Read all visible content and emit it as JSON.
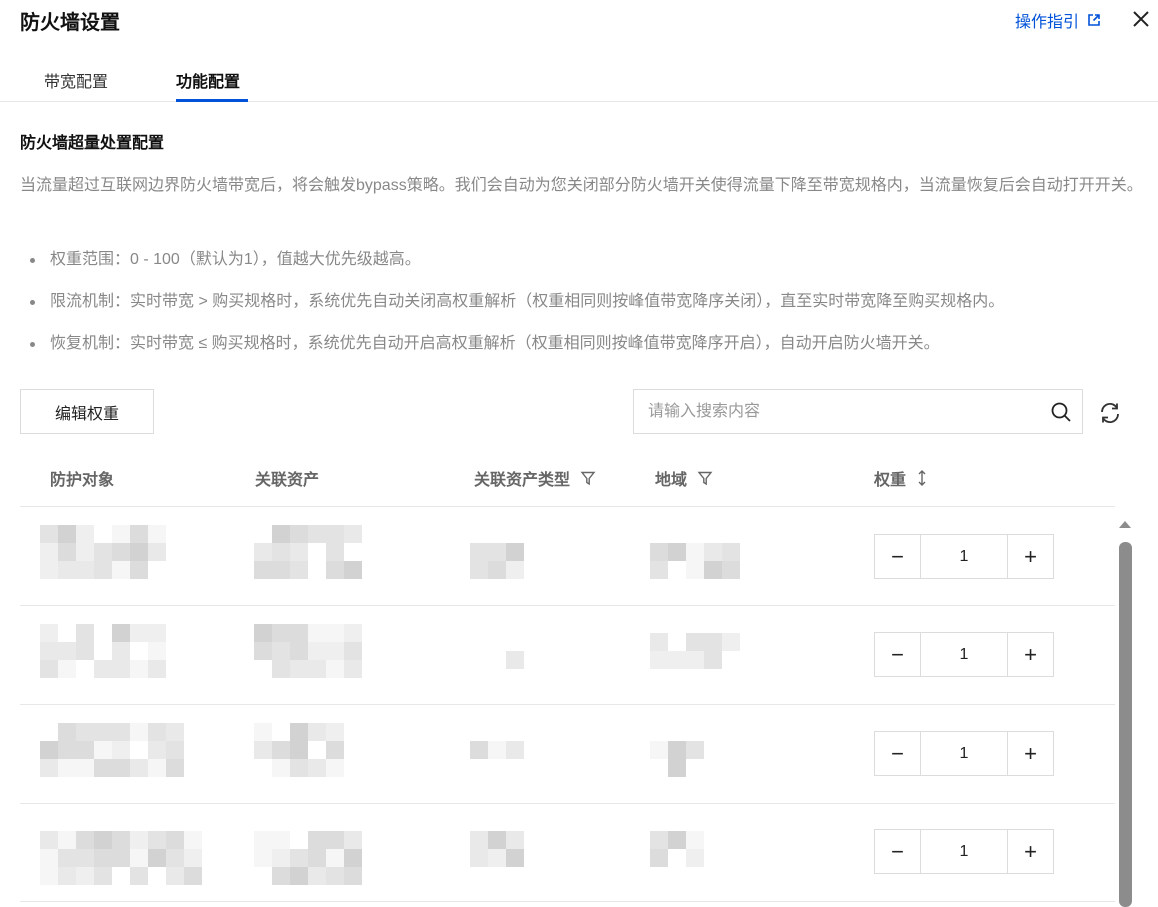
{
  "header": {
    "title": "防火墙设置",
    "guide_label": "操作指引"
  },
  "tabs": [
    {
      "label": "带宽配置",
      "active": false
    },
    {
      "label": "功能配置",
      "active": true
    }
  ],
  "section": {
    "title": "防火墙超量处置配置",
    "description": "当流量超过互联网边界防火墙带宽后，将会触发bypass策略。我们会自动为您关闭部分防火墙开关使得流量下降至带宽规格内，当流量恢复后会自动打开开关。",
    "bullets": [
      "权重范围：0 - 100（默认为1），值越大优先级越高。",
      "限流机制：实时带宽 > 购买规格时，系统优先自动关闭高权重解析（权重相同则按峰值带宽降序关闭），直至实时带宽降至购买规格内。",
      "恢复机制：实时带宽 ≤ 购买规格时，系统优先自动开启高权重解析（权重相同则按峰值带宽降序开启），自动开启防火墙开关。"
    ]
  },
  "toolbar": {
    "edit_label": "编辑权重",
    "search_placeholder": "请输入搜索内容"
  },
  "table": {
    "columns": [
      "防护对象",
      "关联资产",
      "关联资产类型",
      "地域",
      "权重"
    ],
    "rows": [
      {
        "weight": "1"
      },
      {
        "weight": "1"
      },
      {
        "weight": "1"
      },
      {
        "weight": "1"
      }
    ]
  },
  "stepper": {
    "minus": "−",
    "plus": "+"
  },
  "colors": {
    "accent": "#0052d9",
    "muted_text": "#888888",
    "border": "#dcdcdc"
  }
}
